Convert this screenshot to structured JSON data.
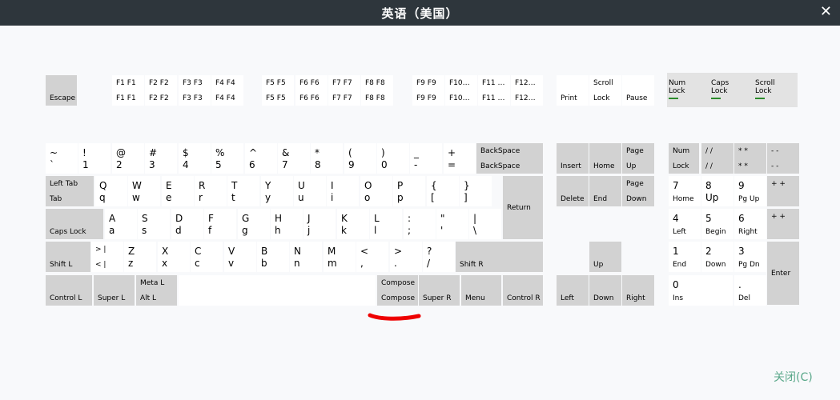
{
  "window": {
    "title": "英语（美国）"
  },
  "footer": {
    "close_label": "关闭(C)"
  },
  "colors": {
    "titlebar": "#2e363c",
    "gray_key": "#d2d2d2",
    "led": "#2b8a2b",
    "mark": "#ee0000",
    "accent": "#5aa88a"
  },
  "leds": [
    {
      "name": "num-lock",
      "line1": "Num",
      "line2": "Lock"
    },
    {
      "name": "caps-lock",
      "line1": "Caps",
      "line2": "Lock"
    },
    {
      "name": "scroll-lock",
      "line1": "Scroll",
      "line2": "Lock"
    }
  ],
  "keys": [
    {
      "id": "escape",
      "bl": "Escape"
    },
    {
      "id": "f1",
      "tl": "F1  F1",
      "bl": "F1  F1"
    },
    {
      "id": "f2",
      "tl": "F2  F2",
      "bl": "F2  F2"
    },
    {
      "id": "f3",
      "tl": "F3  F3",
      "bl": "F3  F3"
    },
    {
      "id": "f4",
      "tl": "F4  F4",
      "bl": "F4  F4"
    },
    {
      "id": "f5",
      "tl": "F5  F5",
      "bl": "F5  F5"
    },
    {
      "id": "f6",
      "tl": "F6  F6",
      "bl": "F6  F6"
    },
    {
      "id": "f7",
      "tl": "F7  F7",
      "bl": "F7  F7"
    },
    {
      "id": "f8",
      "tl": "F8  F8",
      "bl": "F8  F8"
    },
    {
      "id": "f9",
      "tl": "F9  F9",
      "bl": "F9  F9"
    },
    {
      "id": "f10",
      "tl": "F10…",
      "bl": "F10…"
    },
    {
      "id": "f11",
      "tl": "F11 …",
      "bl": "F11 …"
    },
    {
      "id": "f12",
      "tl": "F12…",
      "bl": "F12…"
    },
    {
      "id": "print",
      "bl": "Print"
    },
    {
      "id": "scroll-lock",
      "tl": "Scroll",
      "bl": "Lock"
    },
    {
      "id": "pause",
      "bl": "Pause"
    },
    {
      "id": "grave",
      "tl": "~",
      "bl": "`"
    },
    {
      "id": "1",
      "tl": "!",
      "bl": "1"
    },
    {
      "id": "2",
      "tl": "@",
      "bl": "2"
    },
    {
      "id": "3",
      "tl": "#",
      "bl": "3"
    },
    {
      "id": "4",
      "tl": "$",
      "bl": "4"
    },
    {
      "id": "5",
      "tl": "%",
      "bl": "5"
    },
    {
      "id": "6",
      "tl": "^",
      "bl": "6"
    },
    {
      "id": "7",
      "tl": "&",
      "bl": "7"
    },
    {
      "id": "8",
      "tl": "*",
      "bl": "8"
    },
    {
      "id": "9",
      "tl": "(",
      "bl": "9"
    },
    {
      "id": "0",
      "tl": ")",
      "bl": "0"
    },
    {
      "id": "minus",
      "tl": "_",
      "bl": "-"
    },
    {
      "id": "equal",
      "tl": "+",
      "bl": "="
    },
    {
      "id": "backspace",
      "tl": "BackSpace",
      "bl": "BackSpace"
    },
    {
      "id": "insert",
      "bl": "Insert"
    },
    {
      "id": "home",
      "bl": "Home"
    },
    {
      "id": "page-up",
      "tl": "Page",
      "bl": "Up"
    },
    {
      "id": "num-lock",
      "tl": "Num",
      "bl": "Lock"
    },
    {
      "id": "kp-divide",
      "tl": "/   /",
      "bl": "/   /"
    },
    {
      "id": "kp-multiply",
      "tl": "*   *",
      "bl": "*   *"
    },
    {
      "id": "kp-subtract",
      "tl": "-   -",
      "bl": "-   -"
    },
    {
      "id": "tab",
      "tl": "Left Tab",
      "bl": "Tab"
    },
    {
      "id": "q",
      "tl": "Q",
      "bl": "q"
    },
    {
      "id": "w",
      "tl": "W",
      "bl": "w"
    },
    {
      "id": "e",
      "tl": "E",
      "bl": "e"
    },
    {
      "id": "r",
      "tl": "R",
      "bl": "r"
    },
    {
      "id": "t",
      "tl": "T",
      "bl": "t"
    },
    {
      "id": "y",
      "tl": "Y",
      "bl": "y"
    },
    {
      "id": "u",
      "tl": "U",
      "bl": "u"
    },
    {
      "id": "i",
      "tl": "I",
      "bl": "i"
    },
    {
      "id": "o",
      "tl": "O",
      "bl": "o"
    },
    {
      "id": "p",
      "tl": "P",
      "bl": "p"
    },
    {
      "id": "bracketleft",
      "tl": "{",
      "bl": "["
    },
    {
      "id": "bracketright",
      "tl": "}",
      "bl": "]"
    },
    {
      "id": "return",
      "ml": "Return"
    },
    {
      "id": "delete",
      "bl": "Delete"
    },
    {
      "id": "end",
      "bl": "End"
    },
    {
      "id": "page-down",
      "tl": "Page",
      "bl": "Down"
    },
    {
      "id": "kp7",
      "tl": "7",
      "bl": "Home"
    },
    {
      "id": "kp8",
      "tl": "8",
      "bl": "Up"
    },
    {
      "id": "kp9",
      "tl": "9",
      "bl": "Pg Up"
    },
    {
      "id": "kp-add",
      "tl": "+   +"
    },
    {
      "id": "caps-lock",
      "bl": "Caps Lock"
    },
    {
      "id": "a",
      "tl": "A",
      "bl": "a"
    },
    {
      "id": "s",
      "tl": "S",
      "bl": "s"
    },
    {
      "id": "d",
      "tl": "D",
      "bl": "d"
    },
    {
      "id": "f",
      "tl": "F",
      "bl": "f"
    },
    {
      "id": "g",
      "tl": "G",
      "bl": "g"
    },
    {
      "id": "h",
      "tl": "H",
      "bl": "h"
    },
    {
      "id": "j",
      "tl": "J",
      "bl": "j"
    },
    {
      "id": "k",
      "tl": "K",
      "bl": "k"
    },
    {
      "id": "l",
      "tl": "L",
      "bl": "l"
    },
    {
      "id": "semicolon",
      "tl": ":",
      "bl": ";"
    },
    {
      "id": "apostrophe",
      "tl": "\"",
      "bl": "'"
    },
    {
      "id": "backslash",
      "tl": "|",
      "bl": "\\"
    },
    {
      "id": "kp4",
      "tl": "4",
      "bl": "Left"
    },
    {
      "id": "kp5",
      "tl": "5",
      "bl": "Begin"
    },
    {
      "id": "kp6",
      "tl": "6",
      "bl": "Right"
    },
    {
      "id": "kp-add2",
      "tl": "+   +"
    },
    {
      "id": "shift-l",
      "bl": "Shift L"
    },
    {
      "id": "less",
      "tl": ">  |",
      "bl": "<  |"
    },
    {
      "id": "z",
      "tl": "Z",
      "bl": "z"
    },
    {
      "id": "x",
      "tl": "X",
      "bl": "x"
    },
    {
      "id": "c",
      "tl": "C",
      "bl": "c"
    },
    {
      "id": "v",
      "tl": "V",
      "bl": "v"
    },
    {
      "id": "b",
      "tl": "B",
      "bl": "b"
    },
    {
      "id": "n",
      "tl": "N",
      "bl": "n"
    },
    {
      "id": "m",
      "tl": "M",
      "bl": "m"
    },
    {
      "id": "comma",
      "tl": "<",
      "bl": ","
    },
    {
      "id": "period",
      "tl": ">",
      "bl": "."
    },
    {
      "id": "slash",
      "tl": "?",
      "bl": "/"
    },
    {
      "id": "shift-r",
      "bl": "Shift R"
    },
    {
      "id": "up",
      "bl": "Up"
    },
    {
      "id": "kp1",
      "tl": "1",
      "bl": "End"
    },
    {
      "id": "kp2",
      "tl": "2",
      "bl": "Down"
    },
    {
      "id": "kp3",
      "tl": "3",
      "bl": "Pg Dn"
    },
    {
      "id": "kp-enter",
      "ml": "Enter"
    },
    {
      "id": "control-l",
      "bl": "Control L"
    },
    {
      "id": "super-l",
      "bl": "Super L"
    },
    {
      "id": "alt-l",
      "tl": "Meta L",
      "bl": "Alt L"
    },
    {
      "id": "space"
    },
    {
      "id": "compose",
      "tl": "Compose",
      "bl": "Compose"
    },
    {
      "id": "super-r",
      "bl": "Super R"
    },
    {
      "id": "menu",
      "bl": "Menu"
    },
    {
      "id": "control-r",
      "bl": "Control R"
    },
    {
      "id": "left",
      "bl": "Left"
    },
    {
      "id": "down",
      "bl": "Down"
    },
    {
      "id": "right",
      "bl": "Right"
    },
    {
      "id": "kp0",
      "tl": "0",
      "bl": "Ins"
    },
    {
      "id": "kp-decimal",
      "tl": ".",
      "bl": "Del"
    }
  ]
}
